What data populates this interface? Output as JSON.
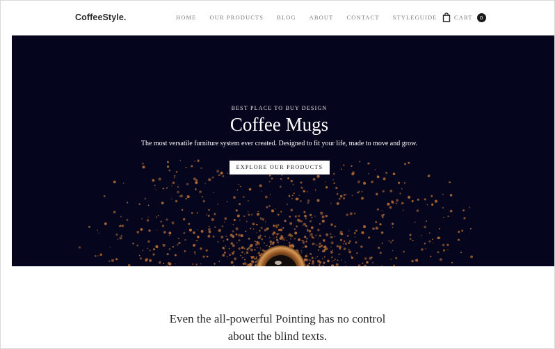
{
  "header": {
    "logo": "CoffeeStyle.",
    "nav": [
      {
        "label": "HOME"
      },
      {
        "label": "OUR PRODUCTS"
      },
      {
        "label": "BLOG"
      },
      {
        "label": "ABOUT"
      },
      {
        "label": "CONTACT"
      },
      {
        "label": "STYLEGUIDE"
      }
    ],
    "cart": {
      "icon": "shopping-bag-icon",
      "label": "CART",
      "count": "0"
    }
  },
  "hero": {
    "eyebrow": "BEST PLACE TO BUY DESIGN",
    "title": "Coffee Mugs",
    "subtitle": "The most versatile furniture system ever created. Designed to fit your life, made to move and grow.",
    "button": "EXPLORE OUR PRODUCTS",
    "background_color": "#05061e",
    "grain_color": "#b06a34"
  },
  "section": {
    "line1": "Even the all-powerful Pointing has no control",
    "line2": "about the blind texts."
  }
}
